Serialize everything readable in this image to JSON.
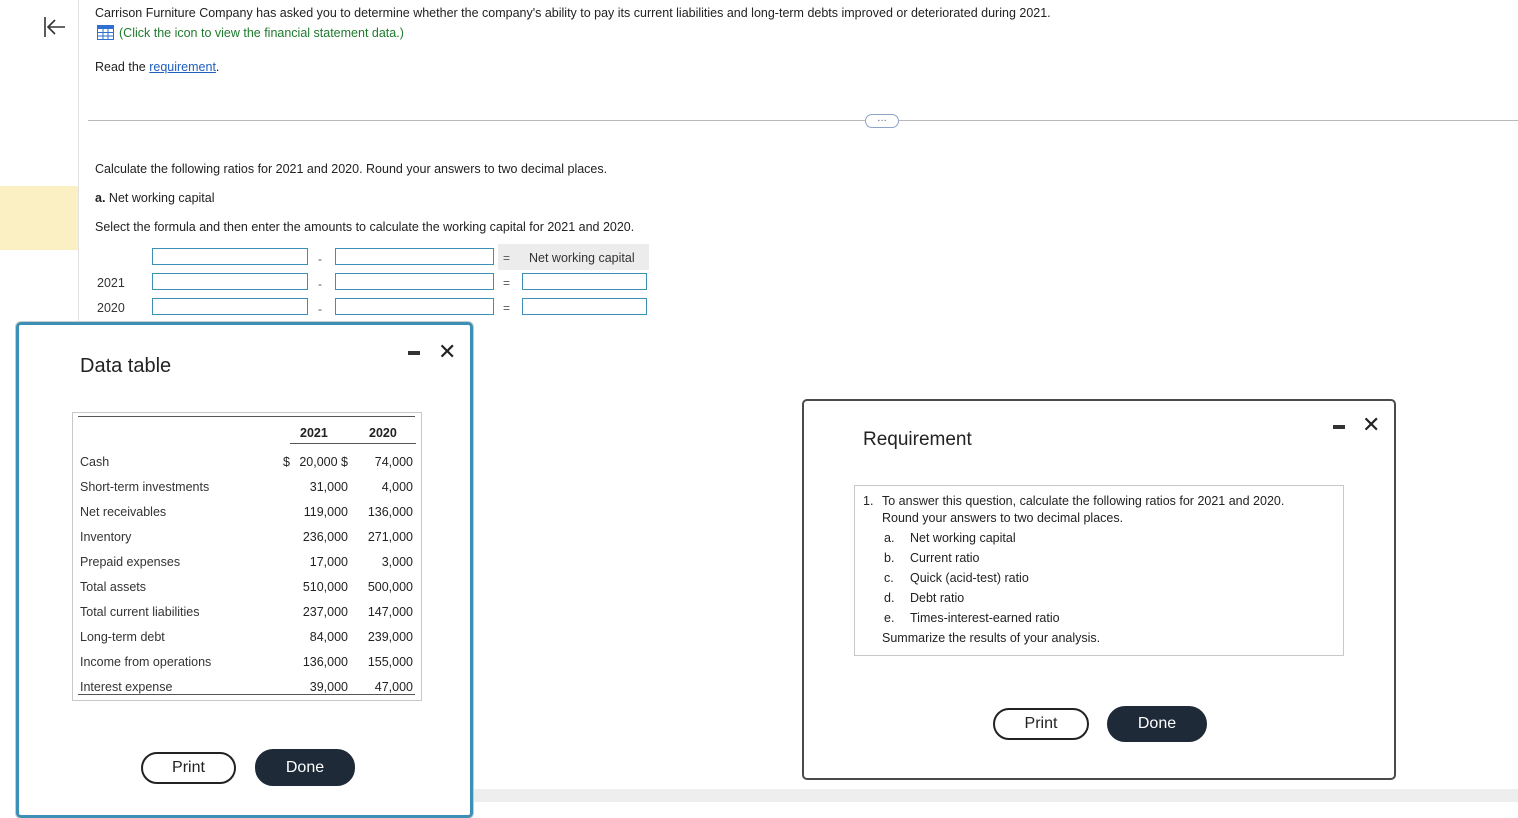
{
  "question": {
    "text": "Carrison Furniture Company has asked you to determine whether the company's ability to pay its current liabilities and long-term debts improved or deteriorated during 2021.",
    "data_link": "(Click the icon to view the financial statement data.)",
    "read_prefix": "Read the ",
    "requirement_link": "requirement",
    "read_suffix": "."
  },
  "ellipsis": "…",
  "part": {
    "instruction": "Calculate the following ratios for 2021 and 2020. Round your answers to two decimal places.",
    "label_letter": "a.",
    "label_text": " Net working capital",
    "select_text": "Select the formula and then enter the amounts to calculate the working capital for 2021 and 2020.",
    "result_header": "Net working capital",
    "minus": "-",
    "equals": "=",
    "years": [
      "2021",
      "2020"
    ]
  },
  "data_table": {
    "title": "Data table",
    "col_2021": "2021",
    "col_2020": "2020",
    "rows": [
      {
        "label": "Cash",
        "dollar": "$",
        "v2021": "20,000 $",
        "v2020": "74,000"
      },
      {
        "label": "Short-term investments",
        "dollar": "",
        "v2021": "31,000",
        "v2020": "4,000"
      },
      {
        "label": "Net receivables",
        "dollar": "",
        "v2021": "119,000",
        "v2020": "136,000"
      },
      {
        "label": "Inventory",
        "dollar": "",
        "v2021": "236,000",
        "v2020": "271,000"
      },
      {
        "label": "Prepaid expenses",
        "dollar": "",
        "v2021": "17,000",
        "v2020": "3,000"
      },
      {
        "label": "Total assets",
        "dollar": "",
        "v2021": "510,000",
        "v2020": "500,000"
      },
      {
        "label": "Total current liabilities",
        "dollar": "",
        "v2021": "237,000",
        "v2020": "147,000"
      },
      {
        "label": "Long-term debt",
        "dollar": "",
        "v2021": "84,000",
        "v2020": "239,000"
      },
      {
        "label": "Income from operations",
        "dollar": "",
        "v2021": "136,000",
        "v2020": "155,000"
      },
      {
        "label": "Interest expense",
        "dollar": "",
        "v2021": "39,000",
        "v2020": "47,000"
      }
    ],
    "print_label": "Print",
    "done_label": "Done"
  },
  "requirement": {
    "title": "Requirement",
    "item_number": "1.",
    "intro_line1": "To answer this question, calculate the following ratios for 2021 and 2020.",
    "intro_line2": "Round your answers to two decimal places.",
    "ratios": [
      {
        "letter": "a.",
        "text": "Net working capital"
      },
      {
        "letter": "b.",
        "text": "Current ratio"
      },
      {
        "letter": "c.",
        "text": "Quick (acid-test) ratio"
      },
      {
        "letter": "d.",
        "text": "Debt ratio"
      },
      {
        "letter": "e.",
        "text": "Times-interest-earned ratio"
      }
    ],
    "summary": "Summarize the results of your analysis.",
    "print_label": "Print",
    "done_label": "Done"
  }
}
